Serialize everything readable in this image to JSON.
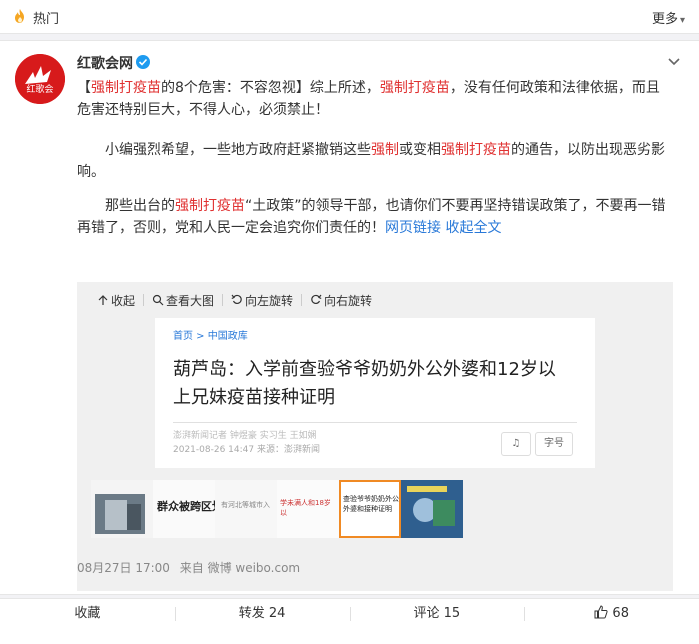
{
  "topbar": {
    "title": "热门",
    "more_label": "更多"
  },
  "post": {
    "author": "红歌会网",
    "avatar_text": "红歌会",
    "paragraphs": [
      [
        {
          "t": "【",
          "c": "n"
        },
        {
          "t": "强制打疫苗",
          "c": "kw"
        },
        {
          "t": "的8个危害：不容忽视】综上所述，",
          "c": "n"
        },
        {
          "t": "强制打疫苗",
          "c": "kw"
        },
        {
          "t": "，没有任何政策和法律依据，而且危害还特别巨大，不得人心，必须禁止！",
          "c": "n"
        }
      ],
      [
        {
          "t": "小编强烈希望，一些地方政府赶紧撤销这些",
          "c": "n"
        },
        {
          "t": "强制",
          "c": "kw"
        },
        {
          "t": "或变相",
          "c": "n"
        },
        {
          "t": "强制打疫苗",
          "c": "kw"
        },
        {
          "t": "的通告，以防出现恶劣影响。",
          "c": "n"
        }
      ],
      [
        {
          "t": "那些出台的",
          "c": "n"
        },
        {
          "t": "强制打疫苗",
          "c": "kw"
        },
        {
          "t": "“土政策”的领导干部，也请你们不要再坚持错误政策了，不要再一错再错了，否则，党和人民一定会追究你们责任的！",
          "c": "n"
        },
        {
          "t": "网页链接",
          "c": "link"
        },
        {
          "t": " ",
          "c": "n"
        },
        {
          "t": "收起全文",
          "c": "link"
        }
      ]
    ],
    "timestamp": "08月27日 17:00",
    "source": "来自 微博 weibo.com"
  },
  "media": {
    "toolbar": {
      "collapse": "收起",
      "view_large": "查看大图",
      "rotate_left": "向左旋转",
      "rotate_right": "向右旋转"
    },
    "preview": {
      "breadcrumb": "首页 > 中国政库",
      "headline": "葫芦岛：入学前查验爷爷奶奶外公外婆和12岁以上兄妹疫苗接种证明",
      "meta_line1": "澎湃新闻记者 钟煜豪 实习生 王如娴",
      "meta_line2": "2021-08-26 14:47 来源：澎湃新闻",
      "btn_follow": "♫",
      "btn_size": "字号"
    },
    "thumbnails": [
      {
        "label": ""
      },
      {
        "label": "群众被跨区划"
      },
      {
        "label": "有河北等城市入"
      },
      {
        "label": "学未满人和18岁以"
      },
      {
        "label": "查验爷爷奶奶外公外婆和接种证明"
      },
      {
        "label": ""
      }
    ]
  },
  "actions": {
    "favorite": "收藏",
    "repost": "转发 24",
    "comment": "评论 15",
    "like": "68"
  },
  "colors": {
    "keyword": "#e03131",
    "link": "#2878d8",
    "selected_thumb": "#f08a24"
  }
}
